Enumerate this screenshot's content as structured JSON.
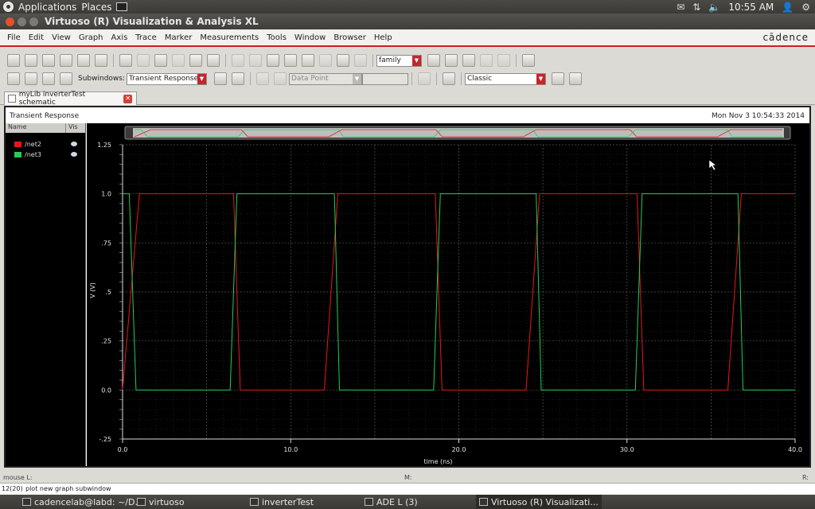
{
  "panel": {
    "applications": "Applications",
    "places": "Places",
    "time": "10:55 AM"
  },
  "window": {
    "title": "Virtuoso (R) Visualization & Analysis XL"
  },
  "menu": {
    "items": [
      "File",
      "Edit",
      "View",
      "Graph",
      "Axis",
      "Trace",
      "Marker",
      "Measurements",
      "Tools",
      "Window",
      "Browser",
      "Help"
    ],
    "brand": "cādence"
  },
  "toolbar": {
    "family_combo": "family",
    "subwindows_label": "Subwindows:",
    "subwindows_value": "Transient Response",
    "data_point_combo": "Data Point",
    "style_combo": "Classic"
  },
  "tab": {
    "label": "myLib inverterTest schematic"
  },
  "plot": {
    "title": "Transient Response",
    "timestamp": "Mon Nov 3 10:54:33 2014",
    "legend_headers": {
      "name": "Name",
      "vis": "Vis"
    },
    "legend": [
      {
        "name": "/net2",
        "color": "#e8161a"
      },
      {
        "name": "/net3",
        "color": "#1fcf5a"
      }
    ]
  },
  "chart_data": {
    "type": "line",
    "xlabel": "time (ns)",
    "ylabel": "V (V)",
    "xlim": [
      0,
      40
    ],
    "ylim": [
      -0.25,
      1.25
    ],
    "xticks": [
      "0.0",
      "10.0",
      "20.0",
      "30.0",
      "40.0"
    ],
    "yticks": [
      "1.25",
      "1.0",
      ".75",
      ".5",
      ".25",
      "0.0",
      "-.25"
    ],
    "grid": true,
    "legend": "left-panel",
    "series": [
      {
        "name": "/net2",
        "color": "#e8161a",
        "x": [
          0,
          1.0,
          6.6,
          7.0,
          12.0,
          12.8,
          18.6,
          19.0,
          24.0,
          24.8,
          30.6,
          31.0,
          36.0,
          36.8,
          40.0
        ],
        "y": [
          0,
          1.0,
          1.0,
          0,
          0,
          1.0,
          1.0,
          0,
          0,
          1.0,
          1.0,
          0,
          0,
          1.0,
          1.0
        ]
      },
      {
        "name": "/net3",
        "color": "#1fcf5a",
        "x": [
          0,
          0.4,
          0.8,
          6.4,
          6.8,
          12.6,
          12.9,
          18.5,
          18.9,
          24.6,
          24.9,
          30.5,
          30.9,
          36.6,
          36.9,
          40.0
        ],
        "y": [
          1.0,
          1.0,
          0,
          0,
          1.0,
          1.0,
          0,
          0,
          1.0,
          1.0,
          0,
          0,
          1.0,
          1.0,
          0,
          0
        ]
      }
    ]
  },
  "status": {
    "mouse_l": "mouse L:",
    "mouse_m": "M:",
    "mouse_r": "R:",
    "command_count": "12(20)",
    "message": "plot new graph subwindow"
  },
  "taskbar": {
    "tasks": [
      "cadencelab@labd: ~/D...",
      "virtuoso",
      "inverterTest",
      "ADE L (3)",
      "Virtuoso (R) Visualizati..."
    ]
  }
}
